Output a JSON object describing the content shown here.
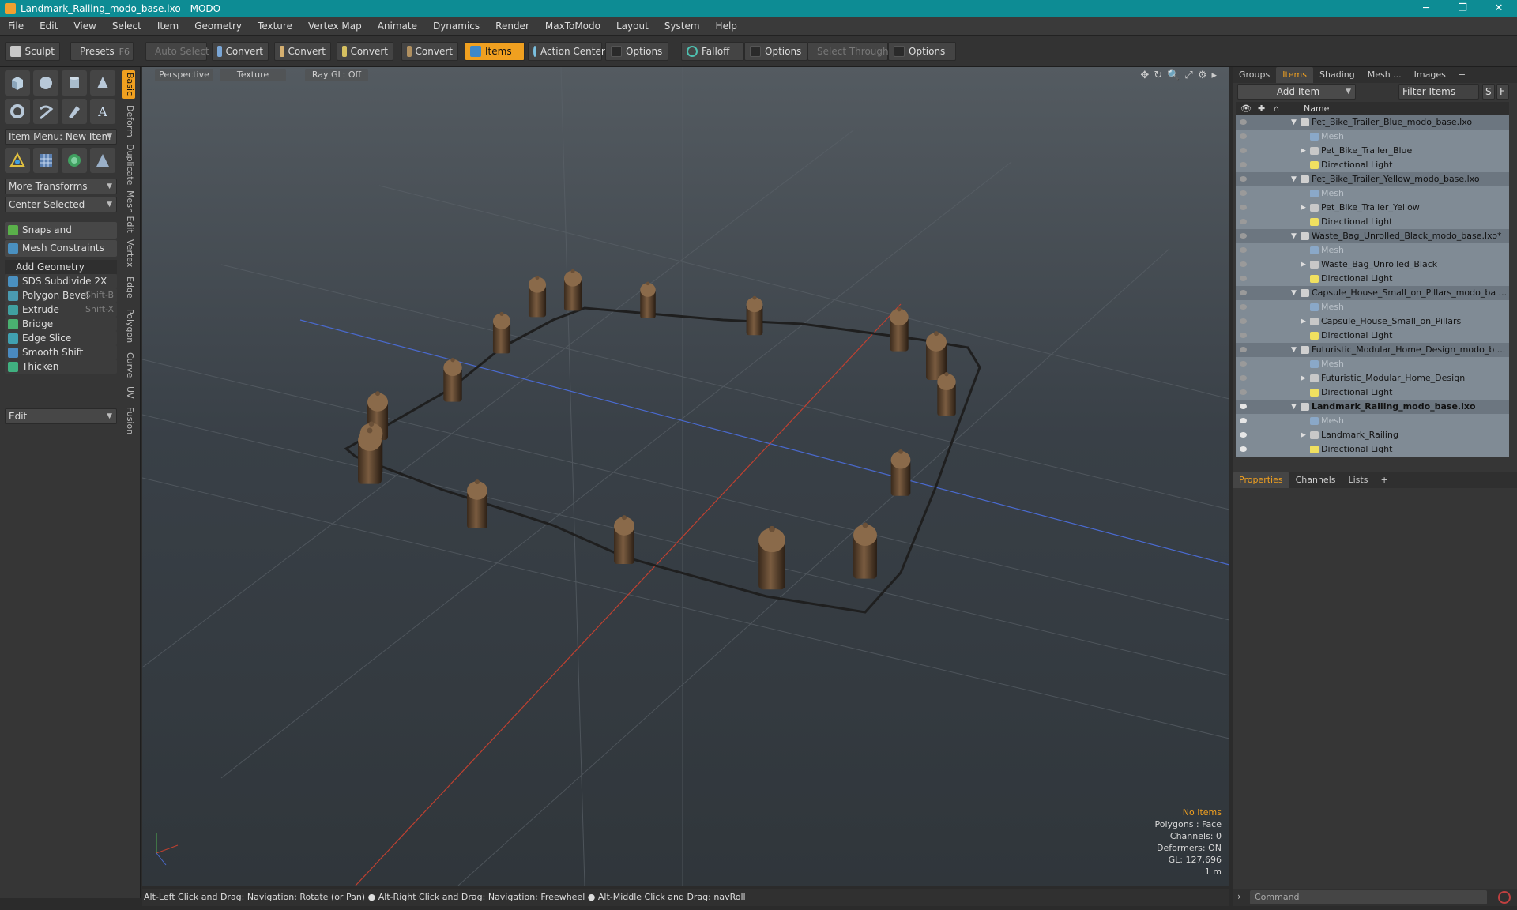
{
  "window": {
    "title": "Landmark_Railing_modo_base.lxo - MODO",
    "minimize": "─",
    "maximize": "❐",
    "close": "✕"
  },
  "menu": [
    "File",
    "Edit",
    "View",
    "Select",
    "Item",
    "Geometry",
    "Texture",
    "Vertex Map",
    "Animate",
    "Dynamics",
    "Render",
    "MaxToModo",
    "Layout",
    "System",
    "Help"
  ],
  "toolbar": {
    "sculpt": "Sculpt",
    "presets": "Presets",
    "presets_key": "F6",
    "auto_select": "Auto Select",
    "convert1": "Convert",
    "convert2": "Convert",
    "convert3": "Convert",
    "convert4": "Convert",
    "items": "Items",
    "action_center": "Action Center",
    "options1": "Options",
    "falloff": "Falloff",
    "options2": "Options",
    "select_through": "Select Through",
    "options3": "Options"
  },
  "left": {
    "item_menu": "Item Menu: New Item",
    "more_transforms": "More Transforms",
    "center_selected": "Center Selected",
    "snaps": "Snaps and Precision",
    "mesh_constraints": "Mesh Constraints",
    "add_geometry": "Add Geometry",
    "tools": [
      {
        "label": "SDS Subdivide 2X",
        "key": ""
      },
      {
        "label": "Polygon Bevel",
        "key": "Shift-B"
      },
      {
        "label": "Extrude",
        "key": "Shift-X"
      },
      {
        "label": "Bridge",
        "key": ""
      },
      {
        "label": "Edge Slice",
        "key": ""
      },
      {
        "label": "Smooth Shift",
        "key": ""
      },
      {
        "label": "Thicken",
        "key": ""
      }
    ],
    "edit": "Edit",
    "vtabs": [
      "Basic",
      "Deform",
      "Duplicate",
      "Mesh Edit",
      "Vertex",
      "Edge",
      "Polygon",
      "Curve",
      "UV",
      "Fusion"
    ]
  },
  "viewport": {
    "perspective": "Perspective",
    "texture": "Texture",
    "raygl": "Ray GL: Off",
    "info": {
      "no_items": "No Items",
      "polygons": "Polygons : Face",
      "channels": "Channels: 0",
      "deformers": "Deformers: ON",
      "gl": "GL: 127,696",
      "scale": "1 m"
    }
  },
  "status": "Alt-Left Click and Drag: Navigation: Rotate (or Pan) ● Alt-Right Click and Drag: Navigation: Freewheel ● Alt-Middle Click and Drag: navRoll",
  "right": {
    "tabs": [
      "Groups",
      "Items",
      "Shading",
      "Mesh ...",
      "Images",
      "+"
    ],
    "add_item": "Add Item",
    "filter": "Filter Items",
    "s": "S",
    "f": "F",
    "name_col": "Name",
    "tree": [
      {
        "name": "Pet_Bike_Trailer_Blue_modo_base.lxo",
        "kind": "scene"
      },
      {
        "name": "Mesh",
        "kind": "mesh"
      },
      {
        "name": "Pet_Bike_Trailer_Blue",
        "kind": "item"
      },
      {
        "name": "Directional Light",
        "kind": "light"
      },
      {
        "name": "Pet_Bike_Trailer_Yellow_modo_base.lxo",
        "kind": "scene"
      },
      {
        "name": "Mesh",
        "kind": "mesh"
      },
      {
        "name": "Pet_Bike_Trailer_Yellow",
        "kind": "item"
      },
      {
        "name": "Directional Light",
        "kind": "light"
      },
      {
        "name": "Waste_Bag_Unrolled_Black_modo_base.lxo*",
        "kind": "scene"
      },
      {
        "name": "Mesh",
        "kind": "mesh"
      },
      {
        "name": "Waste_Bag_Unrolled_Black",
        "kind": "item"
      },
      {
        "name": "Directional Light",
        "kind": "light"
      },
      {
        "name": "Capsule_House_Small_on_Pillars_modo_ba ...",
        "kind": "scene"
      },
      {
        "name": "Mesh",
        "kind": "mesh"
      },
      {
        "name": "Capsule_House_Small_on_Pillars",
        "kind": "item"
      },
      {
        "name": "Directional Light",
        "kind": "light"
      },
      {
        "name": "Futuristic_Modular_Home_Design_modo_b ...",
        "kind": "scene"
      },
      {
        "name": "Mesh",
        "kind": "mesh"
      },
      {
        "name": "Futuristic_Modular_Home_Design",
        "kind": "item"
      },
      {
        "name": "Directional Light",
        "kind": "light"
      },
      {
        "name": "Landmark_Railing_modo_base.lxo",
        "kind": "scene",
        "bold": true
      },
      {
        "name": "Mesh",
        "kind": "mesh"
      },
      {
        "name": "Landmark_Railing",
        "kind": "item"
      },
      {
        "name": "Directional Light",
        "kind": "light"
      }
    ],
    "bottom_tabs": [
      "Properties",
      "Channels",
      "Lists",
      "+"
    ],
    "command_placeholder": "Command"
  }
}
